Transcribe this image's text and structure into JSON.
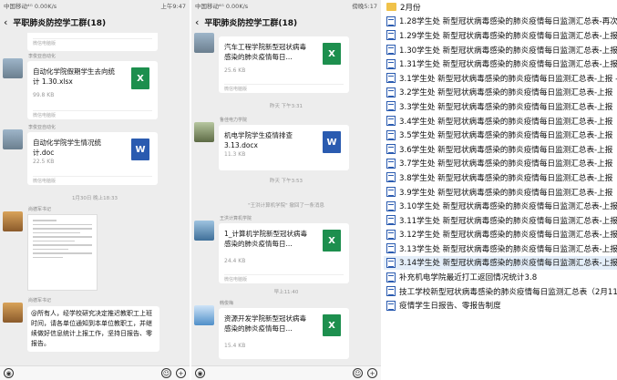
{
  "screen1": {
    "status": {
      "left": "中国移动⁴ᴳ 0.00K/s",
      "right": "上午9:47"
    },
    "title": "平职肺炎防控学工群(18)",
    "top_foot": "微信电脑版",
    "messages": [
      {
        "sender": "李俊亚自动化",
        "file": "自动化学院假期学生去向统计 1.30.xlsx",
        "size": "99.8 KB",
        "foot": "微信电脑版",
        "type": "X"
      },
      {
        "sender": "李俊亚自动化",
        "file": "自动化学院学生情况统计.doc",
        "size": "22.5 KB",
        "foot": "微信电脑版",
        "type": "W"
      }
    ],
    "timestamp": "1月30日 晚上18:33",
    "image_sender": "尚德军书记",
    "text_sender": "尚德军书记",
    "text": "@所有人，经学校研究决定推迟教职工上班时间，请各单位通知到本单位教职工，并继续做好信息统计上报工作，坚持日报告、零报告。"
  },
  "screen2": {
    "status": {
      "left": "中国移动⁴ᴳ 0.00K/s",
      "right": "傍晚5:17"
    },
    "title": "平职肺炎防控学工群(18)",
    "messages": [
      {
        "sender": "李俊亚自动化",
        "file": "汽车工程学院新型冠状病毒感染的肺炎疫情每日...",
        "size": "25.6 KB",
        "foot": "微信电脑版",
        "type": "X"
      },
      {
        "sender": "鲁佳电力学院",
        "file": "机电学院学生疫情排查3.13.docx",
        "size": "11.3 KB",
        "foot": "",
        "type": "W"
      },
      {
        "sender": "王洪计算机学院",
        "file": "1_计算机学院新型冠状病毒感染的肺炎疫情每日...",
        "size": "24.4 KB",
        "foot": "微信电脑版",
        "type": "X"
      },
      {
        "sender": "韩俊梅",
        "file": "资源开发学院新型冠状病毒感染的肺炎疫情每日...",
        "size": "15.4 KB",
        "foot": "",
        "type": "X"
      }
    ],
    "ts1": "昨天 下午3:31",
    "ts2": "昨天 下午3:53",
    "recall": "\"王洪计算机学院\" 撤回了一条消息",
    "ts3": "早上11:40"
  },
  "filelist": {
    "items": [
      {
        "label": "2月份",
        "kind": "folder",
        "selected": false
      },
      {
        "label": "1.28学生处 新型冠状病毒感染的肺炎疫情每日监测汇总表-再次",
        "kind": "file",
        "selected": false
      },
      {
        "label": "1.29学生处 新型冠状病毒感染的肺炎疫情每日监测汇总表-上报",
        "kind": "file",
        "selected": false
      },
      {
        "label": "1.30学生处 新型冠状病毒感染的肺炎疫情每日监测汇总表-上报",
        "kind": "file",
        "selected": false
      },
      {
        "label": "1.31学生处 新型冠状病毒感染的肺炎疫情每日监测汇总表-上报",
        "kind": "file",
        "selected": false
      },
      {
        "label": "3.1学生处 新型冠状病毒感染的肺炎疫情每日监测汇总表-上报 -",
        "kind": "file",
        "selected": false
      },
      {
        "label": "3.2学生处 新型冠状病毒感染的肺炎疫情每日监测汇总表-上报",
        "kind": "file",
        "selected": false
      },
      {
        "label": "3.3学生处 新型冠状病毒感染的肺炎疫情每日监测汇总表-上报",
        "kind": "file",
        "selected": false
      },
      {
        "label": "3.4学生处 新型冠状病毒感染的肺炎疫情每日监测汇总表-上报",
        "kind": "file",
        "selected": false
      },
      {
        "label": "3.5学生处 新型冠状病毒感染的肺炎疫情每日监测汇总表-上报",
        "kind": "file",
        "selected": false
      },
      {
        "label": "3.6学生处 新型冠状病毒感染的肺炎疫情每日监测汇总表-上报",
        "kind": "file",
        "selected": false
      },
      {
        "label": "3.7学生处 新型冠状病毒感染的肺炎疫情每日监测汇总表-上报",
        "kind": "file",
        "selected": false
      },
      {
        "label": "3.8学生处 新型冠状病毒感染的肺炎疫情每日监测汇总表-上报",
        "kind": "file",
        "selected": false
      },
      {
        "label": "3.9学生处 新型冠状病毒感染的肺炎疫情每日监测汇总表-上报",
        "kind": "file",
        "selected": false
      },
      {
        "label": "3.10学生处 新型冠状病毒感染的肺炎疫情每日监测汇总表-上报",
        "kind": "file",
        "selected": false
      },
      {
        "label": "3.11学生处 新型冠状病毒感染的肺炎疫情每日监测汇总表-上报",
        "kind": "file",
        "selected": false
      },
      {
        "label": "3.12学生处 新型冠状病毒感染的肺炎疫情每日监测汇总表-上报",
        "kind": "file",
        "selected": false
      },
      {
        "label": "3.13学生处 新型冠状病毒感染的肺炎疫情每日监测汇总表-上报",
        "kind": "file",
        "selected": false
      },
      {
        "label": "3.14学生处 新型冠状病毒感染的肺炎疫情每日监测汇总表-上报",
        "kind": "file",
        "selected": true
      },
      {
        "label": "补充机电学院最近打工返回情况统计3.8",
        "kind": "file",
        "selected": false
      },
      {
        "label": "技工学校新型冠状病毒感染的肺炎疫情每日监测汇总表（2月11日",
        "kind": "file",
        "selected": false
      },
      {
        "label": "疫情学生日报告、零报告制度",
        "kind": "file",
        "selected": false
      }
    ]
  }
}
